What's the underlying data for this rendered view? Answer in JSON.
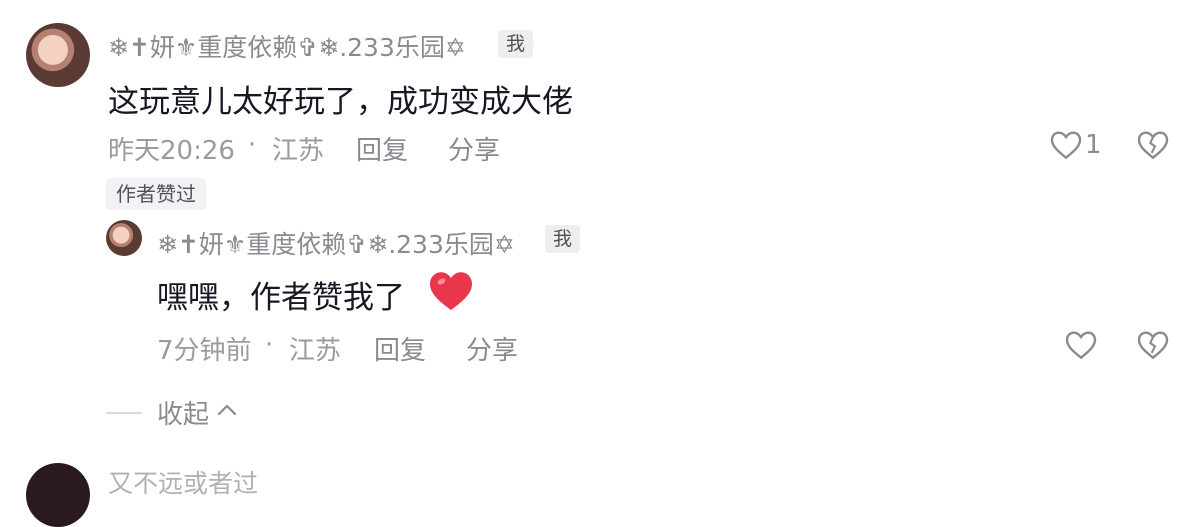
{
  "comment": {
    "username": "❄✝妍⚜重度依赖✞❄.233乐园✡",
    "me_badge": "我",
    "content": "这玩意儿太好玩了，成功变成大佬",
    "time": "昨天20:26",
    "dot": "·",
    "location": "江苏",
    "reply_label": "回复",
    "share_label": "分享",
    "like_count": "1",
    "author_liked_tag": "作者赞过"
  },
  "reply": {
    "username": "❄✝妍⚜重度依赖✞❄.233乐园✡",
    "me_badge": "我",
    "content": "嘿嘿，作者赞我了",
    "time": "7分钟前",
    "dot": "·",
    "location": "江苏",
    "reply_label": "回复",
    "share_label": "分享"
  },
  "collapse_label": "收起",
  "next_comment_partial": "又不远或者过",
  "colors": {
    "heart_emoji": "#e8374a",
    "text_primary": "#161823",
    "text_secondary": "#8a8b91"
  },
  "icons": [
    "heart-outline-icon",
    "broken-heart-icon",
    "chevron-up-icon",
    "red-heart-emoji"
  ]
}
